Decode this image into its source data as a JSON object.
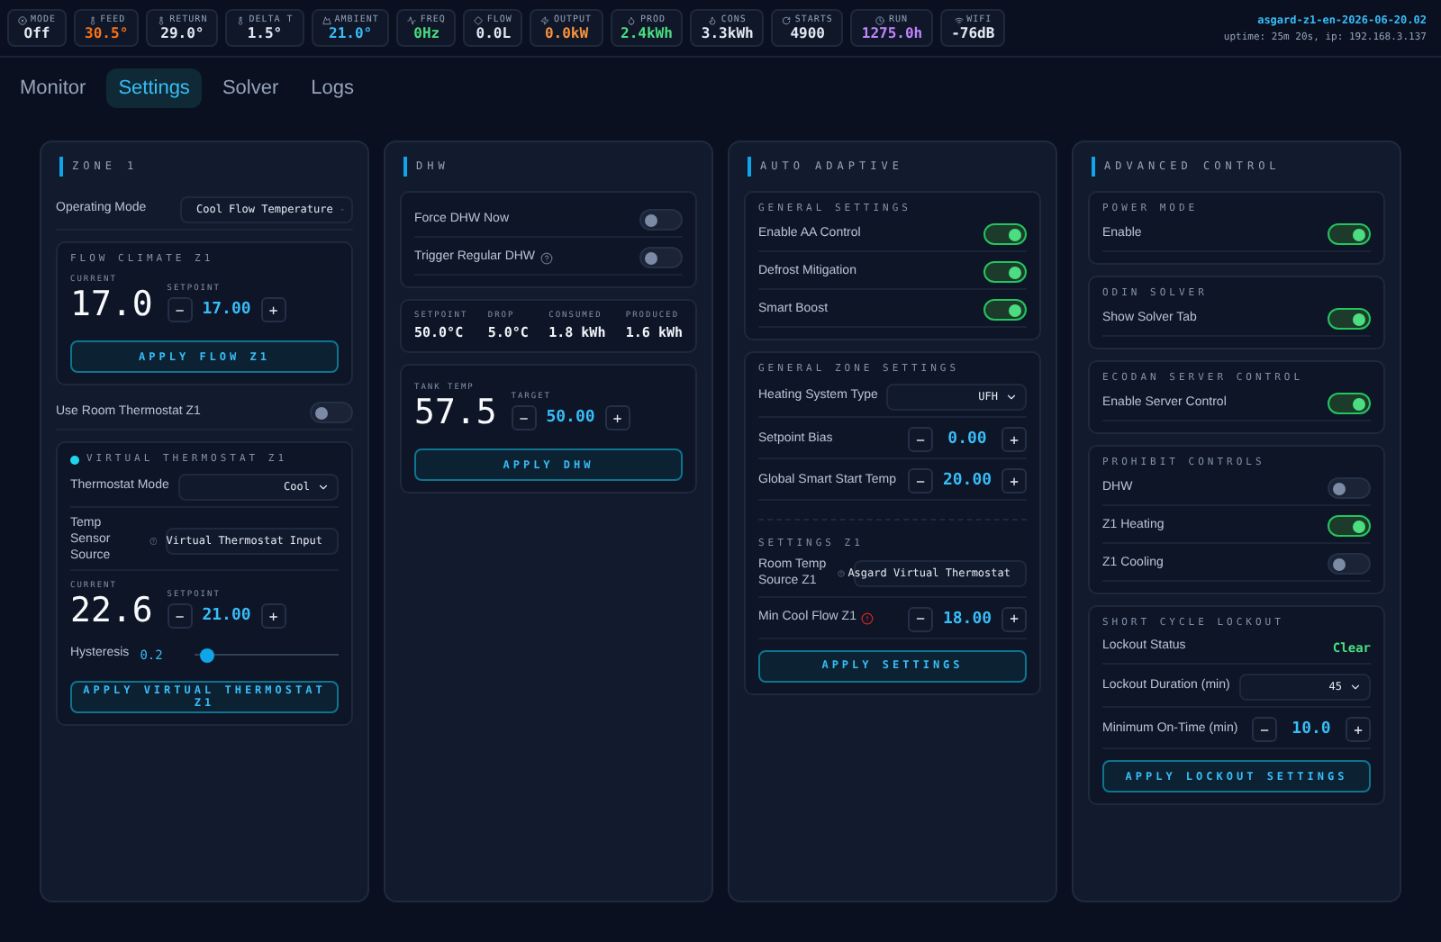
{
  "top_bar": {
    "stats": [
      {
        "label": "MODE",
        "value": "Off",
        "color": "#e2e8f0"
      },
      {
        "label": "FEED",
        "value": "30.5°",
        "color": "#f97316"
      },
      {
        "label": "RETURN",
        "value": "29.0°",
        "color": "#e2e8f0"
      },
      {
        "label": "DELTA T",
        "value": "1.5°",
        "color": "#e2e8f0"
      },
      {
        "label": "AMBIENT",
        "value": "21.0°",
        "color": "#38bdf8"
      },
      {
        "label": "FREQ",
        "value": "0Hz",
        "color": "#4ade80"
      },
      {
        "label": "FLOW",
        "value": "0.0L",
        "color": "#e2e8f0"
      },
      {
        "label": "OUTPUT",
        "value": "0.0kW",
        "color": "#fb923c"
      },
      {
        "label": "PROD",
        "value": "2.4kWh",
        "color": "#4ade80"
      },
      {
        "label": "CONS",
        "value": "3.3kWh",
        "color": "#e2e8f0"
      },
      {
        "label": "STARTS",
        "value": "4900",
        "color": "#e2e8f0"
      },
      {
        "label": "RUN",
        "value": "1275.0h",
        "color": "#c084fc"
      },
      {
        "label": "WIFI",
        "value": "-76dB",
        "color": "#e2e8f0"
      }
    ],
    "device": "asgard-z1-en-2026-06-20.02",
    "uptime": "uptime: 25m 20s, ip: 192.168.3.137"
  },
  "tabs": [
    {
      "label": "Monitor",
      "selected": false
    },
    {
      "label": "Settings",
      "selected": true
    },
    {
      "label": "Solver",
      "selected": false
    },
    {
      "label": "Logs",
      "selected": false
    }
  ],
  "panels": [
    {
      "title": "ZONE 1",
      "items": [
        {
          "kind": "select",
          "label": "Operating Mode",
          "value": "Cool Flow Temperature"
        },
        {
          "kind": "card",
          "title": "FLOW CLIMATE Z1",
          "items": [
            {
              "kind": "climate",
              "current_label": "CURRENT",
              "current": "17.0",
              "setpoint_label": "SETPOINT",
              "setpoint": "17.00",
              "minus": "−",
              "plus": "+"
            },
            {
              "kind": "button",
              "label": "APPLY FLOW Z1"
            }
          ]
        },
        {
          "kind": "toggle",
          "label": "Use Room Thermostat Z1",
          "on": false
        },
        {
          "kind": "card",
          "title": "VIRTUAL THERMOSTAT Z1",
          "active": true,
          "items": [
            {
              "kind": "select",
              "label": "Thermostat Mode",
              "value": "Cool"
            },
            {
              "kind": "select",
              "label": "Temp Sensor Source",
              "note": {
                "kind": "help"
              },
              "value": "Virtual Thermostat Input"
            },
            {
              "kind": "climate",
              "current_label": "CURRENT",
              "current": "22.6",
              "setpoint_label": "SETPOINT",
              "setpoint": "21.00",
              "minus": "−",
              "plus": "+"
            },
            {
              "kind": "slider",
              "label": "Hysteresis",
              "reading": "0.2",
              "level": 0.08
            },
            {
              "kind": "button",
              "label": "APPLY VIRTUAL THERMOSTAT Z1"
            }
          ]
        }
      ]
    },
    {
      "title": "DHW",
      "items": [
        {
          "kind": "card",
          "items": [
            {
              "kind": "toggle",
              "label": "Force DHW Now",
              "on": false
            },
            {
              "kind": "toggle",
              "label": "Trigger Regular DHW",
              "note": {
                "kind": "help"
              },
              "on": false
            }
          ]
        },
        {
          "kind": "card",
          "items": [
            {
              "kind": "metrics",
              "items": [
                {
                  "label": "SETPOINT",
                  "value": "50.0°C"
                },
                {
                  "label": "DROP",
                  "value": "5.0°C"
                },
                {
                  "label": "CONSUMED",
                  "value": "1.8 kWh"
                },
                {
                  "label": "PRODUCED",
                  "value": "1.6 kWh"
                }
              ]
            }
          ]
        },
        {
          "kind": "card",
          "items": [
            {
              "kind": "climate",
              "current_label": "TANK TEMP",
              "current": "57.5",
              "setpoint_label": "TARGET",
              "setpoint": "50.00",
              "minus": "−",
              "plus": "+"
            },
            {
              "kind": "button",
              "label": "APPLY DHW"
            }
          ]
        }
      ]
    },
    {
      "title": "AUTO ADAPTIVE",
      "items": [
        {
          "kind": "card",
          "title": "GENERAL SETTINGS",
          "items": [
            {
              "kind": "toggle",
              "label": "Enable AA Control",
              "on": true
            },
            {
              "kind": "toggle",
              "label": "Defrost Mitigation",
              "on": true
            },
            {
              "kind": "toggle",
              "label": "Smart Boost",
              "on": true
            }
          ]
        },
        {
          "kind": "card",
          "title": "GENERAL ZONE SETTINGS",
          "items": [
            {
              "kind": "select",
              "label": "Heating System Type",
              "value": "UFH"
            },
            {
              "kind": "stepper",
              "label": "Setpoint Bias",
              "value": "0.00",
              "minus": "−",
              "plus": "+"
            },
            {
              "kind": "stepper",
              "label": "Global Smart Start Temp",
              "value": "20.00",
              "minus": "−",
              "plus": "+"
            },
            {
              "kind": "heading",
              "label": "SETTINGS Z1"
            },
            {
              "kind": "select",
              "label": "Room Temp Source Z1",
              "note": {
                "kind": "help"
              },
              "value": "Asgard Virtual Thermostat"
            },
            {
              "kind": "stepper",
              "label": "Min Cool Flow Z1",
              "note": {
                "kind": "warning"
              },
              "value": "18.00",
              "minus": "−",
              "plus": "+"
            },
            {
              "kind": "button",
              "label": "APPLY SETTINGS"
            }
          ]
        }
      ]
    },
    {
      "title": "ADVANCED CONTROL",
      "items": [
        {
          "kind": "card",
          "title": "POWER MODE",
          "items": [
            {
              "kind": "toggle",
              "label": "Enable",
              "on": true
            }
          ]
        },
        {
          "kind": "card",
          "title": "ODIN SOLVER",
          "items": [
            {
              "kind": "toggle",
              "label": "Show Solver Tab",
              "on": true
            }
          ]
        },
        {
          "kind": "card",
          "title": "ECODAN SERVER CONTROL",
          "items": [
            {
              "kind": "toggle",
              "label": "Enable Server Control",
              "on": true
            }
          ]
        },
        {
          "kind": "card",
          "title": "PROHIBIT CONTROLS",
          "items": [
            {
              "kind": "toggle",
              "label": "DHW",
              "on": false
            },
            {
              "kind": "toggle",
              "label": "Z1 Heating",
              "on": true
            },
            {
              "kind": "toggle",
              "label": "Z1 Cooling",
              "on": false
            }
          ]
        },
        {
          "kind": "card",
          "title": "SHORT CYCLE LOCKOUT",
          "items": [
            {
              "kind": "status",
              "label": "Lockout Status",
              "value": "Clear"
            },
            {
              "kind": "select",
              "label": "Lockout Duration (min)",
              "value": "45"
            },
            {
              "kind": "stepper",
              "label": "Minimum On-Time (min)",
              "value": "10.0",
              "minus": "−",
              "plus": "+"
            },
            {
              "kind": "button",
              "label": "APPLY LOCKOUT SETTINGS"
            }
          ]
        }
      ]
    }
  ]
}
